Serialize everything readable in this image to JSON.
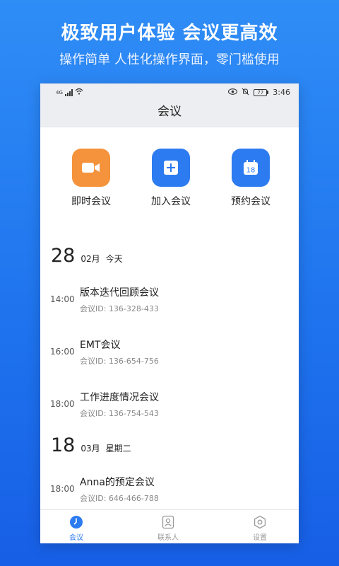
{
  "promo": {
    "title": "极致用户体验 会议更高效",
    "subtitle": "操作简单 人性化操作界面，零门槛使用"
  },
  "status_bar": {
    "network": "4G",
    "battery": "77",
    "time": "3:46"
  },
  "header": {
    "title": "会议"
  },
  "actions": [
    {
      "label": "即时会议",
      "icon": "video-camera-icon",
      "color": "#f5933c"
    },
    {
      "label": "加入会议",
      "icon": "plus-icon",
      "color": "#2d7bf0"
    },
    {
      "label": "预约会议",
      "icon": "calendar-icon",
      "color": "#2d7bf0",
      "badge": "18"
    }
  ],
  "days": [
    {
      "day": "28",
      "month": "02月",
      "weekday": "今天",
      "meetings": [
        {
          "time": "14:00",
          "title": "版本迭代回顾会议",
          "id": "会议ID: 136-328-433"
        },
        {
          "time": "16:00",
          "title": "EMT会议",
          "id": "会议ID: 136-654-756"
        },
        {
          "time": "18:00",
          "title": "工作进度情况会议",
          "id": "会议ID: 136-754-543"
        }
      ]
    },
    {
      "day": "18",
      "month": "03月",
      "weekday": "星期二",
      "meetings": [
        {
          "time": "18:00",
          "title": "Anna的预定会议",
          "id": "会议ID: 646-466-788"
        }
      ]
    }
  ],
  "tabs": [
    {
      "label": "会议",
      "icon": "meeting-clock-icon",
      "active": true
    },
    {
      "label": "联系人",
      "icon": "contacts-icon",
      "active": false
    },
    {
      "label": "设置",
      "icon": "settings-gear-icon",
      "active": false
    }
  ],
  "colors": {
    "accent": "#2d7bf0",
    "orange": "#f5933c",
    "background": "#1f74ee"
  }
}
